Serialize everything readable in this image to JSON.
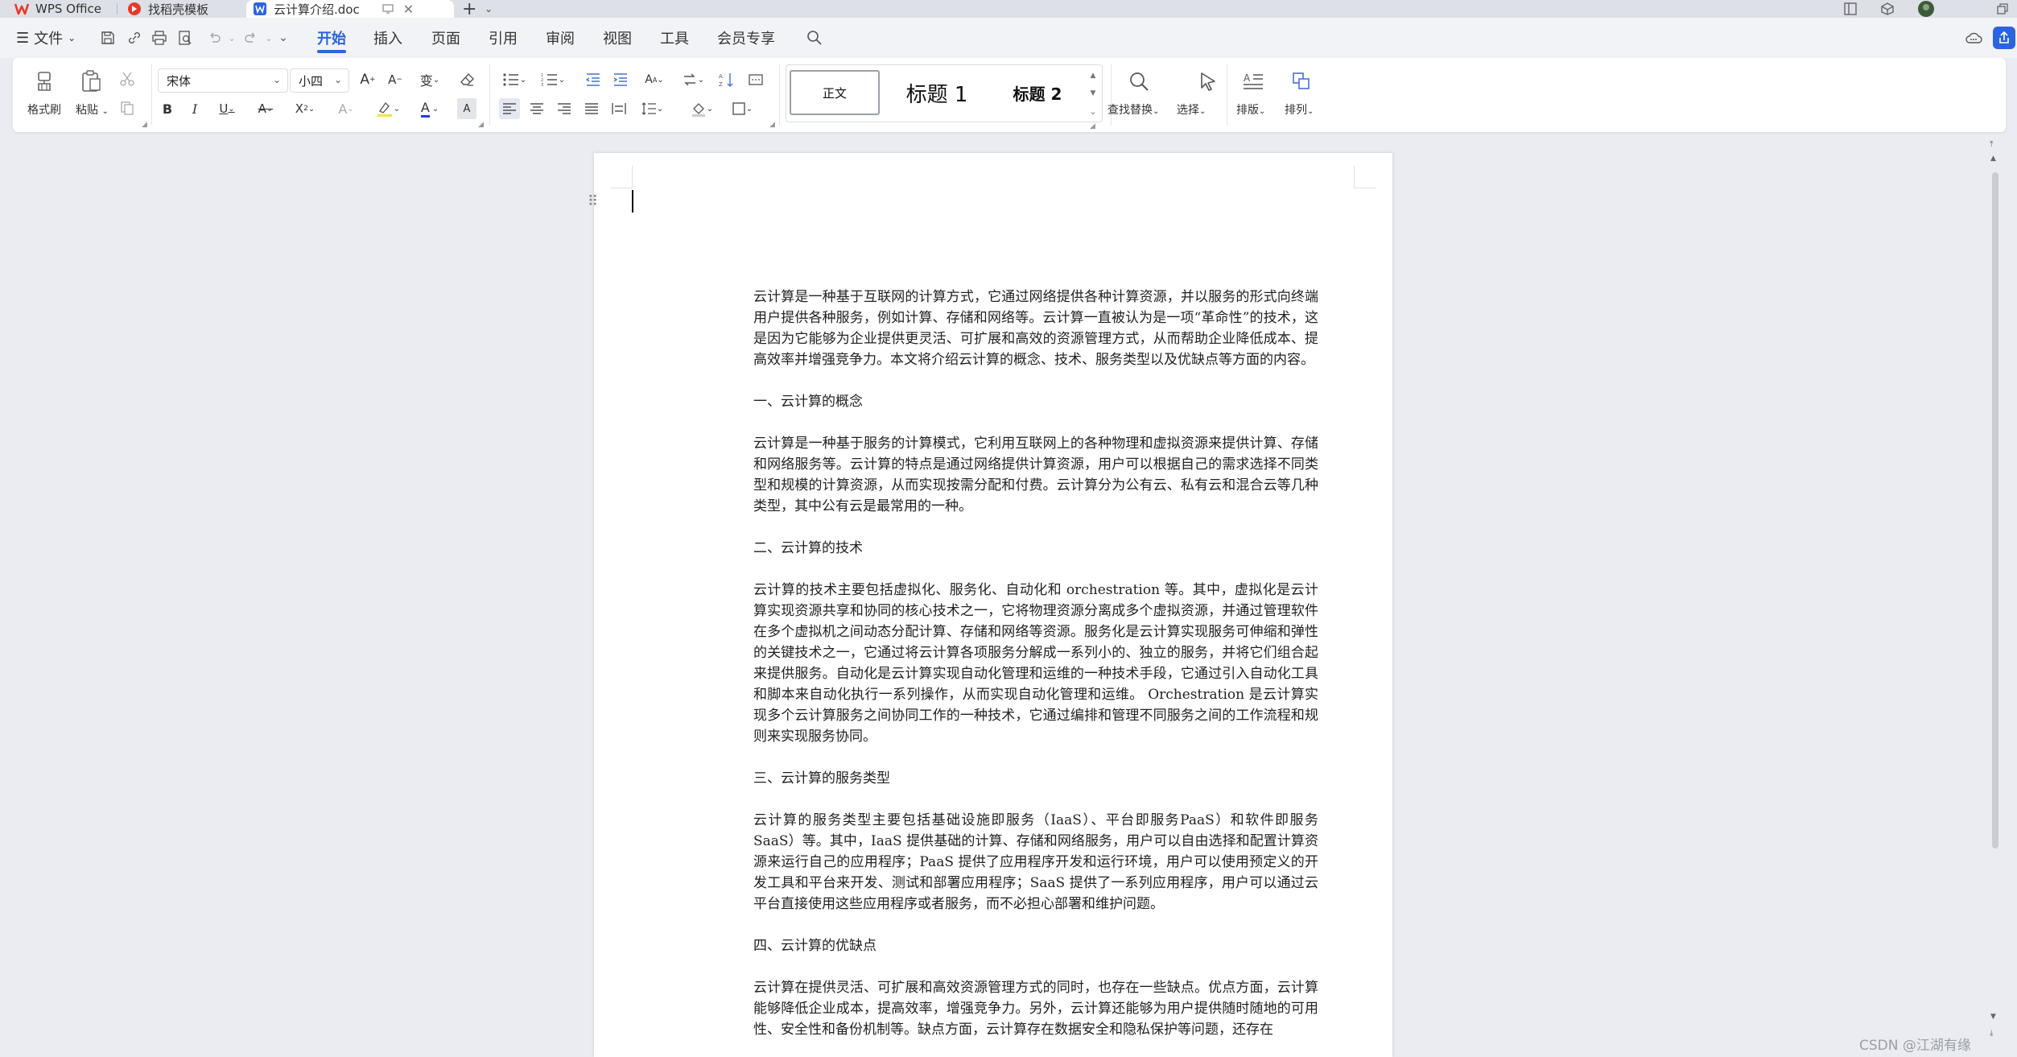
{
  "tabs": [
    {
      "label": "WPS Office",
      "icon": "wps-logo-icon"
    },
    {
      "label": "找稻壳模板",
      "icon": "daoke-logo-icon"
    },
    {
      "label": "云计算介绍.doc",
      "icon": "word-doc-icon",
      "active": true
    }
  ],
  "menu": {
    "file": "文件",
    "tabs": [
      "开始",
      "插入",
      "页面",
      "引用",
      "审阅",
      "视图",
      "工具",
      "会员专享"
    ],
    "active_tab": "开始"
  },
  "ribbon": {
    "format_painter": "格式刷",
    "paste": "粘贴",
    "font_name": "宋体",
    "font_size": "小四",
    "styles": {
      "normal": "正文",
      "heading1": "标题 1",
      "heading2": "标题 2"
    },
    "find_replace": "查找替换",
    "select": "选择",
    "layout": "排版",
    "arrange": "排列"
  },
  "document": {
    "paragraphs": [
      {
        "type": "body",
        "text": "云计算是一种基于互联网的计算方式，它通过网络提供各种计算资源，并以服务的形式向终端用户提供各种服务，例如计算、存储和网络等。云计算一直被认为是一项“革命性”的技术，这是因为它能够为企业提供更灵活、可扩展和高效的资源管理方式，从而帮助企业降低成本、提高效率并增强竞争力。本文将介绍云计算的概念、技术、服务类型以及优缺点等方面的内容。"
      },
      {
        "type": "heading",
        "text": "一、云计算的概念"
      },
      {
        "type": "body",
        "text": "云计算是一种基于服务的计算模式，它利用互联网上的各种物理和虚拟资源来提供计算、存储和网络服务等。云计算的特点是通过网络提供计算资源，用户可以根据自己的需求选择不同类型和规模的计算资源，从而实现按需分配和付费。云计算分为公有云、私有云和混合云等几种类型，其中公有云是最常用的一种。"
      },
      {
        "type": "heading",
        "text": "二、云计算的技术"
      },
      {
        "type": "body",
        "text": "云计算的技术主要包括虚拟化、服务化、自动化和 orchestration 等。其中，虚拟化是云计算实现资源共享和协同的核心技术之一，它将物理资源分离成多个虚拟资源，并通过管理软件在多个虚拟机之间动态分配计算、存储和网络等资源。服务化是云计算实现服务可伸缩和弹性的关键技术之一，它通过将云计算各项服务分解成一系列小的、独立的服务，并将它们组合起来提供服务。自动化是云计算实现自动化管理和运维的一种技术手段，它通过引入自动化工具和脚本来自动化执行一系列操作，从而实现自动化管理和运维。 Orchestration 是云计算实现多个云计算服务之间协同工作的一种技术，它通过编排和管理不同服务之间的工作流程和规则来实现服务协同。"
      },
      {
        "type": "heading",
        "text": "三、云计算的服务类型"
      },
      {
        "type": "body",
        "text": "云计算的服务类型主要包括基础设施即服务（IaaS）、平台即服务PaaS）和软件即服务 SaaS）等。其中，IaaS 提供基础的计算、存储和网络服务，用户可以自由选择和配置计算资源来运行自己的应用程序；PaaS 提供了应用程序开发和运行环境，用户可以使用预定义的开发工具和平台来开发、测试和部署应用程序；SaaS 提供了一系列应用程序，用户可以通过云平台直接使用这些应用程序或者服务，而不必担心部署和维护问题。"
      },
      {
        "type": "heading",
        "text": "四、云计算的优缺点"
      },
      {
        "type": "body",
        "text": "云计算在提供灵活、可扩展和高效资源管理方式的同时，也存在一些缺点。优点方面，云计算能够降低企业成本，提高效率，增强竞争力。另外，云计算还能够为用户提供随时随地的可用性、安全性和备份机制等。缺点方面，云计算存在数据安全和隐私保护等问题，还存在"
      }
    ]
  },
  "watermark": "CSDN @江湖有缘"
}
